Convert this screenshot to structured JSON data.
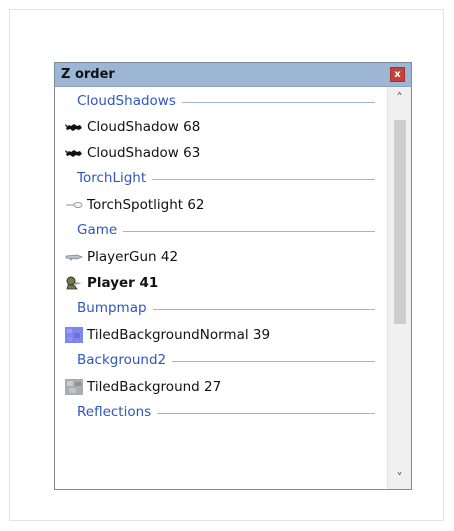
{
  "window": {
    "title": "Z order",
    "close_label": "x"
  },
  "groups": [
    {
      "label": "CloudShadows"
    },
    {
      "label": "TorchLight"
    },
    {
      "label": "Game"
    },
    {
      "label": "Bumpmap"
    },
    {
      "label": "Background2"
    },
    {
      "label": "Reflections"
    }
  ],
  "items": [
    {
      "label": "CloudShadow 68",
      "icon": "cloud-shadow-icon",
      "bold": false
    },
    {
      "label": "CloudShadow 63",
      "icon": "cloud-shadow-icon",
      "bold": false
    },
    {
      "label": "TorchSpotlight 62",
      "icon": "torch-spotlight-icon",
      "bold": false
    },
    {
      "label": "PlayerGun 42",
      "icon": "player-gun-icon",
      "bold": false
    },
    {
      "label": "Player 41",
      "icon": "player-icon",
      "bold": true
    },
    {
      "label": "TiledBackgroundNormal 39",
      "icon": "normal-map-icon",
      "bold": false
    },
    {
      "label": "TiledBackground 27",
      "icon": "tiled-background-icon",
      "bold": false
    }
  ],
  "scrollbar": {
    "up_arrow": "˄",
    "down_arrow": "˅"
  },
  "colors": {
    "title_bar": "#9db6d3",
    "group_label": "#2f55c4",
    "close_button": "#c9403b"
  }
}
